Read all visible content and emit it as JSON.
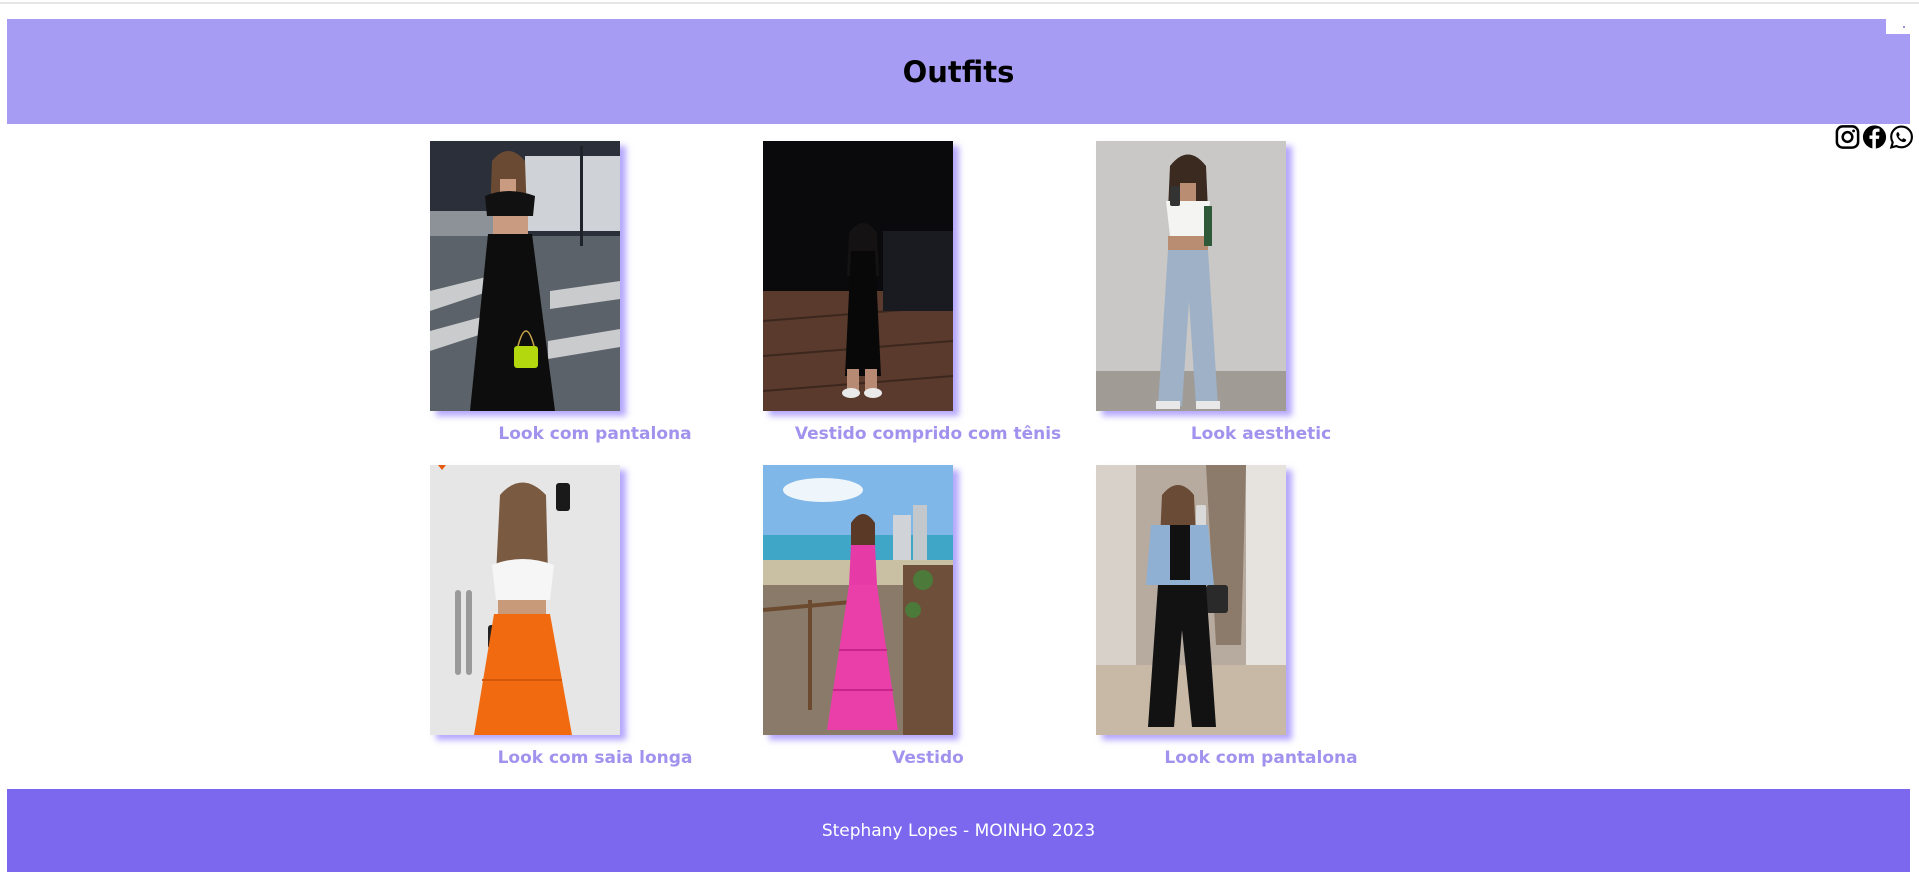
{
  "header": {
    "title": "Outfits"
  },
  "social": {
    "icons": [
      "instagram-icon",
      "facebook-icon",
      "whatsapp-icon"
    ]
  },
  "gallery": {
    "items": [
      {
        "caption": "Look com pantalona"
      },
      {
        "caption": "Vestido comprido com tênis"
      },
      {
        "caption": "Look aesthetic"
      },
      {
        "caption": "Look com saia longa"
      },
      {
        "caption": "Vestido"
      },
      {
        "caption": "Look com pantalona"
      }
    ]
  },
  "footer": {
    "text": "Stephany Lopes - MOINHO 2023"
  },
  "colors": {
    "header_bg": "#a69cf3",
    "footer_bg": "#7b68ee",
    "caption": "#a192ee"
  }
}
